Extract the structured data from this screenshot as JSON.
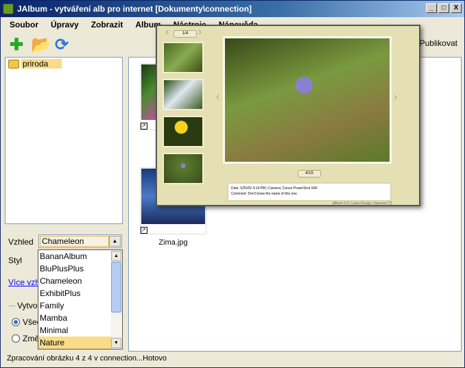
{
  "window": {
    "title": "JAlbum - vytváření alb pro internet [Dokumenty\\connection]",
    "min": "_",
    "max": "□",
    "close": "X"
  },
  "menu": [
    "Soubor",
    "Úpravy",
    "Zobrazit",
    "Album",
    "Nástroje",
    "Nápověda"
  ],
  "toolbar": {
    "publish": "Publikovat"
  },
  "tree": {
    "folder": "priroda"
  },
  "files": [
    {
      "name": "Zima.jpg"
    }
  ],
  "settings": {
    "vzhled_label": "Vzhled",
    "vzhled_value": "Chameleon",
    "styl_label": "Styl",
    "more_link": "Více vzhledů",
    "group_label": "Vytvořit",
    "radio1": "Všechny",
    "radio2": "Změněné"
  },
  "dropdown": {
    "options": [
      "BananAlbum",
      "BluPlusPlus",
      "Chameleon",
      "ExhibitPlus",
      "Family",
      "Mamba",
      "Minimal",
      "Nature"
    ],
    "selected": "Nature"
  },
  "preview": {
    "thumb_counter": "1/4",
    "image_counter": "4/15",
    "caption_line1": "Date: 5/20/02 4:14 PM | Camera: Canon PowerShot S40",
    "caption_line2": "Comment: Don't know the name of this one.",
    "footer": "jAlbum 5.0 | Lasle Design | Sponsor [?]"
  },
  "status": "Zpracování obrázku 4 z 4 v connection...Hotovo"
}
